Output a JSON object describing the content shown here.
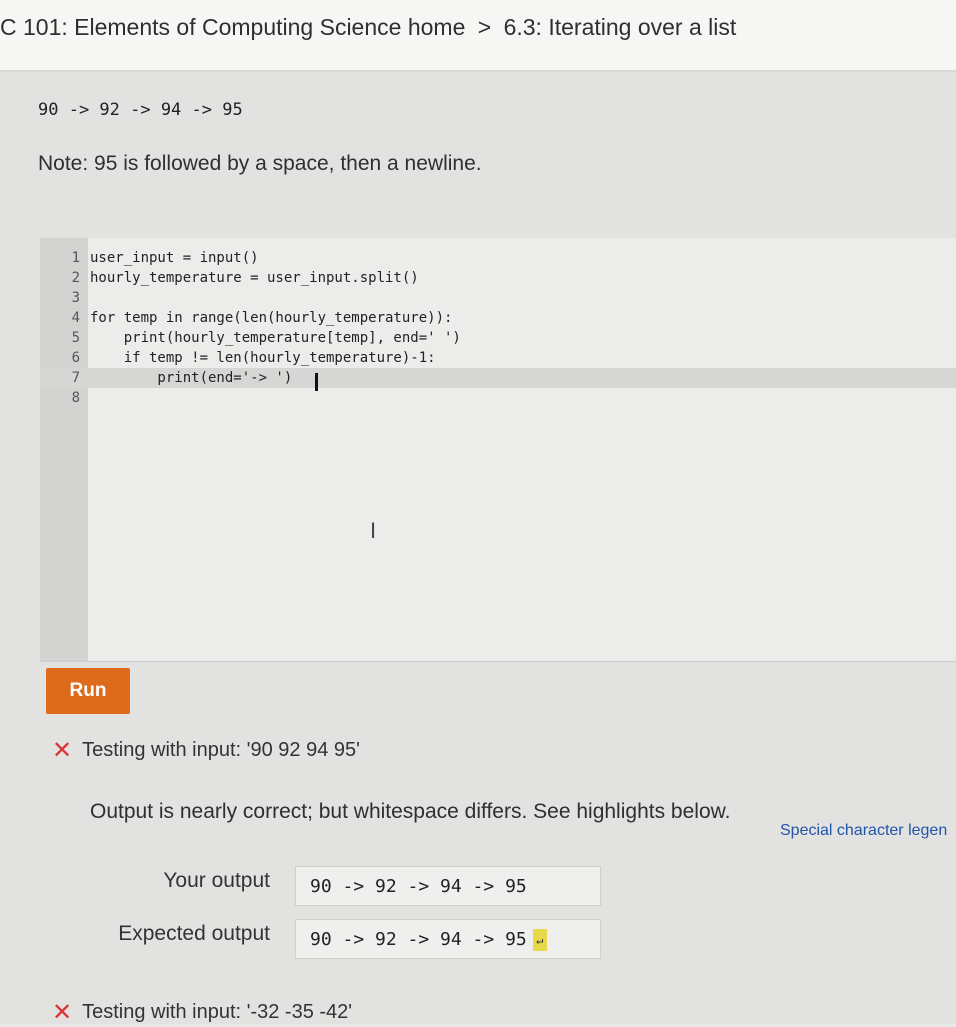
{
  "breadcrumb": {
    "course": "C 101: Elements of Computing Science home",
    "separator": ">",
    "section": "6.3: Iterating over a list"
  },
  "sample_output": "90 -> 92 -> 94 -> 95",
  "note": "Note: 95 is followed by a space, then a newline.",
  "editor": {
    "lines": [
      {
        "num": "1",
        "code": "user_input = input()"
      },
      {
        "num": "2",
        "code": "hourly_temperature = user_input.split()"
      },
      {
        "num": "3",
        "code": ""
      },
      {
        "num": "4",
        "code": "for temp in range(len(hourly_temperature)):"
      },
      {
        "num": "5",
        "code": "    print(hourly_temperature[temp], end=' ')"
      },
      {
        "num": "6",
        "code": "    if temp != len(hourly_temperature)-1:"
      },
      {
        "num": "7",
        "code": "        print(end='-> ')"
      },
      {
        "num": "8",
        "code": ""
      }
    ]
  },
  "run_button": "Run",
  "test1": {
    "label": "Testing with input: '90 92 94 95'"
  },
  "feedback": "Output is nearly correct; but whitespace differs. See highlights below.",
  "legend_link": "Special character legen",
  "your_output": {
    "label": "Your output",
    "value": "90 -> 92 -> 94 -> 95"
  },
  "expected_output": {
    "label": "Expected output",
    "value": "90 -> 92 -> 94 -> 95",
    "newline_glyph": "↵"
  },
  "test2": {
    "label": "Testing with input: '-32 -35 -42'"
  },
  "colors": {
    "run_button": "#de6b1c",
    "fail_icon": "#dd3333",
    "link": "#2355a8",
    "newline_highlight": "#e9d94a"
  }
}
